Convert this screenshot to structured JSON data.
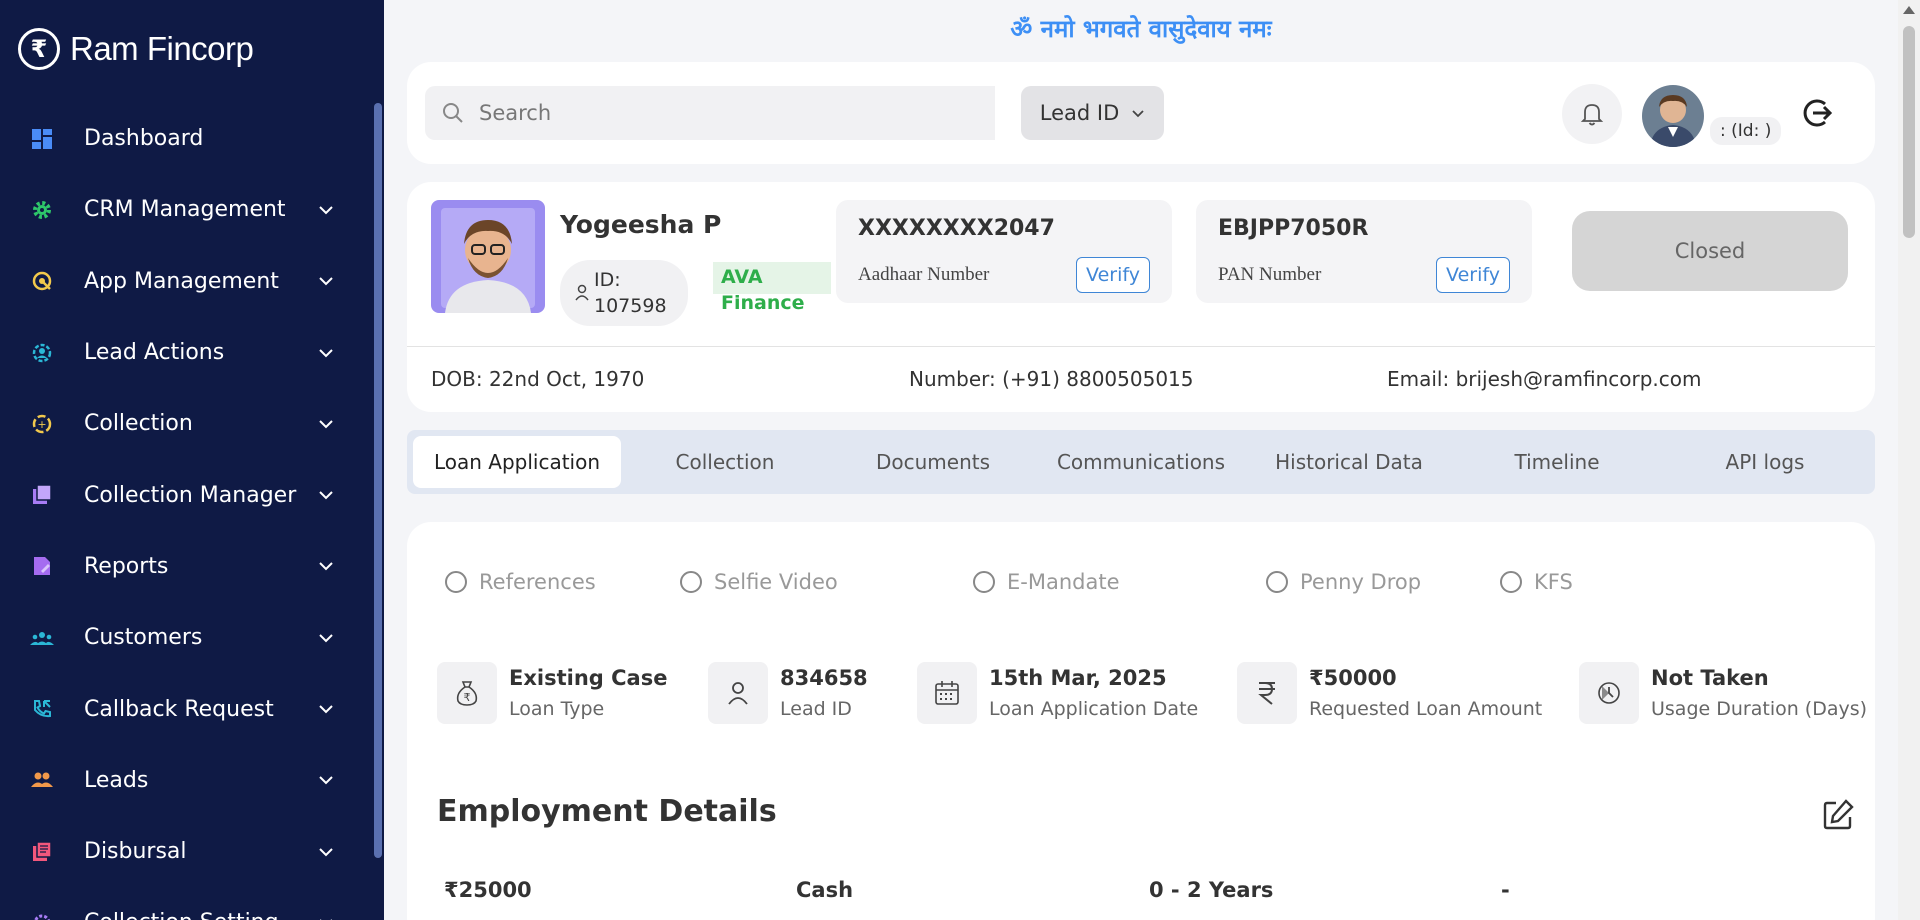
{
  "brand": {
    "logo_glyph": "₹",
    "name": "Ram Fincorp"
  },
  "sidebar": {
    "items": [
      {
        "label": "Dashboard",
        "icon": "dashboard-icon",
        "color": "#4a8cf7",
        "has_submenu": false
      },
      {
        "label": "CRM Management",
        "icon": "gear-icon",
        "color": "#2ec76a",
        "has_submenu": true
      },
      {
        "label": "App Management",
        "icon": "app-settings-icon",
        "color": "#f2c94c",
        "has_submenu": true
      },
      {
        "label": "Lead Actions",
        "icon": "lead-actions-icon",
        "color": "#2bb7d6",
        "has_submenu": true
      },
      {
        "label": "Collection",
        "icon": "collection-icon",
        "color": "#f2c94c",
        "has_submenu": true
      },
      {
        "label": "Collection Manager",
        "icon": "collection-manager-icon",
        "color": "#a77cf5",
        "has_submenu": true
      },
      {
        "label": "Reports",
        "icon": "reports-icon",
        "color": "#a56cf0",
        "has_submenu": true
      },
      {
        "label": "Customers",
        "icon": "customers-icon",
        "color": "#2bb7d6",
        "has_submenu": true
      },
      {
        "label": "Callback Request",
        "icon": "phone-callback-icon",
        "color": "#2bb7d6",
        "has_submenu": true
      },
      {
        "label": "Leads",
        "icon": "leads-icon",
        "color": "#f2994a",
        "has_submenu": true
      },
      {
        "label": "Disbursal",
        "icon": "disbursal-icon",
        "color": "#f2577c",
        "has_submenu": true
      },
      {
        "label": "Collection Setting",
        "icon": "collection-setting-icon",
        "color": "#a77cf5",
        "has_submenu": true
      }
    ]
  },
  "header": {
    "mantra": "ॐ नमो भगवते वासुदेवाय नमः",
    "search": {
      "placeholder": "Search",
      "select_value": "Lead ID"
    },
    "user_id_text": ": (Id: )"
  },
  "profile": {
    "name": "Yogeesha P",
    "id_text": "ID: 107598",
    "partner": "AVA Finance",
    "aadhaar": {
      "value": "XXXXXXXX2047",
      "label": "Aadhaar Number",
      "verify_label": "Verify"
    },
    "pan": {
      "value": "EBJPP7050R",
      "label": "PAN Number",
      "verify_label": "Verify"
    },
    "status": "Closed",
    "dob": "DOB: 22nd Oct, 1970",
    "number": "Number: (+91) 8800505015",
    "email": "Email: brijesh@ramfincorp.com"
  },
  "tabs": [
    {
      "label": "Loan Application",
      "active": true
    },
    {
      "label": "Collection",
      "active": false
    },
    {
      "label": "Documents",
      "active": false
    },
    {
      "label": "Communications",
      "active": false
    },
    {
      "label": "Historical Data",
      "active": false
    },
    {
      "label": "Timeline",
      "active": false
    },
    {
      "label": "API logs",
      "active": false
    }
  ],
  "checks": [
    "References",
    "Selfie Video",
    "E-Mandate",
    "Penny Drop",
    "KFS"
  ],
  "stats": [
    {
      "value": "Existing Case",
      "label": "Loan Type",
      "icon": "money-bag-icon"
    },
    {
      "value": "834658",
      "label": "Lead ID",
      "icon": "user-icon"
    },
    {
      "value": "15th Mar, 2025",
      "label": "Loan Application Date",
      "icon": "calendar-icon"
    },
    {
      "value": "₹50000",
      "label": "Requested Loan Amount",
      "icon": "rupee-icon"
    },
    {
      "value": "Not Taken",
      "label": "Usage Duration (Days)",
      "icon": "clock-icon"
    }
  ],
  "employment": {
    "title": "Employment Details",
    "values": [
      "₹25000",
      "Cash",
      "0 - 2 Years",
      "-"
    ]
  }
}
